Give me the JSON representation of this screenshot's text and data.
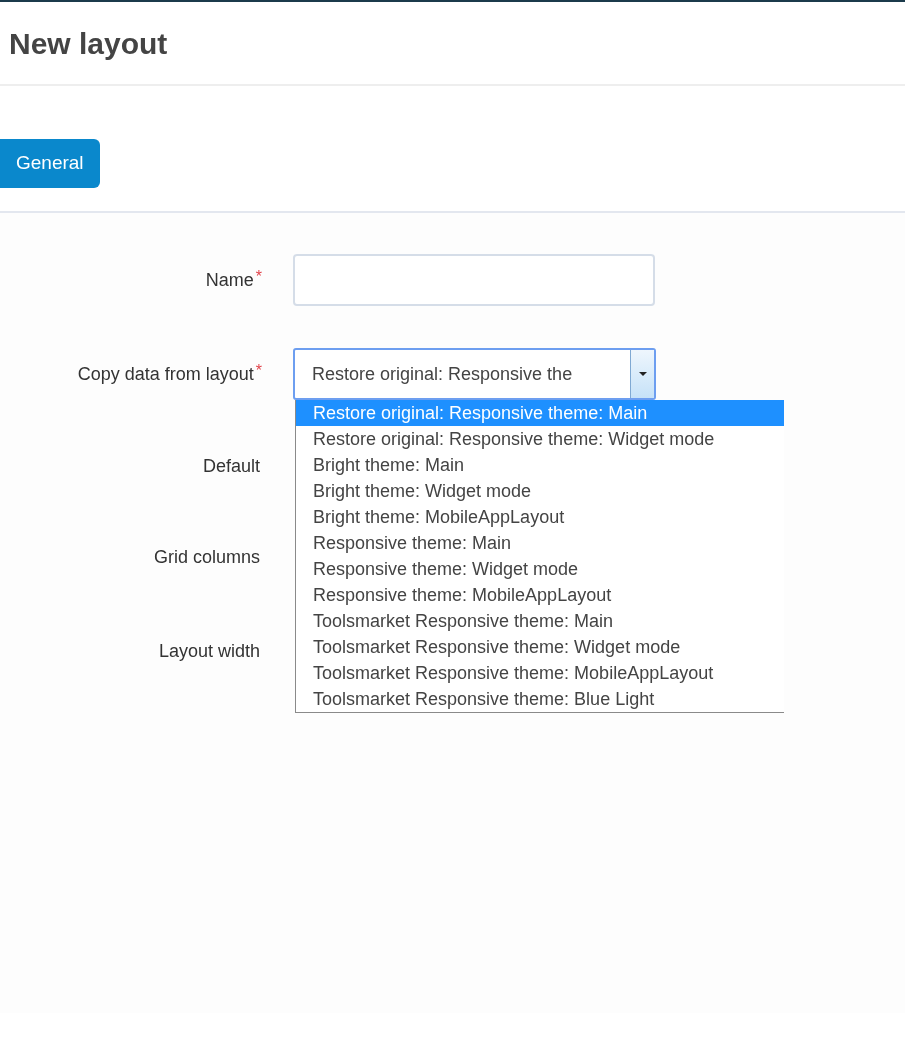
{
  "title": "New layout",
  "tabs": [
    {
      "label": "General",
      "selected": true
    }
  ],
  "fields": [
    {
      "kind": "input",
      "label": "Name",
      "required_mark": "*"
    },
    {
      "kind": "select",
      "label": "Copy data from layout",
      "required_mark": "*",
      "value": "Restore original: Responsive the",
      "options": [
        {
          "label": "Restore original: Responsive theme: Main",
          "selected": true
        },
        {
          "label": "Restore original: Responsive theme: Widget mode",
          "selected": false
        },
        {
          "label": "Bright theme: Main",
          "selected": false
        },
        {
          "label": "Bright theme: Widget mode",
          "selected": false
        },
        {
          "label": "Bright theme: MobileAppLayout",
          "selected": false
        },
        {
          "label": "Responsive theme: Main",
          "selected": false
        },
        {
          "label": "Responsive theme: Widget mode",
          "selected": false
        },
        {
          "label": "Responsive theme: MobileAppLayout",
          "selected": false
        },
        {
          "label": "Toolsmarket Responsive theme: Main",
          "selected": false
        },
        {
          "label": "Toolsmarket Responsive theme: Widget mode",
          "selected": false
        },
        {
          "label": "Toolsmarket Responsive theme: MobileAppLayout",
          "selected": false
        },
        {
          "label": "Toolsmarket Responsive theme: Blue Light",
          "selected": false
        }
      ]
    },
    {
      "kind": "hidden",
      "label": "Default"
    },
    {
      "kind": "hidden",
      "label": "Grid columns"
    },
    {
      "kind": "hidden",
      "label": "Layout width"
    }
  ]
}
